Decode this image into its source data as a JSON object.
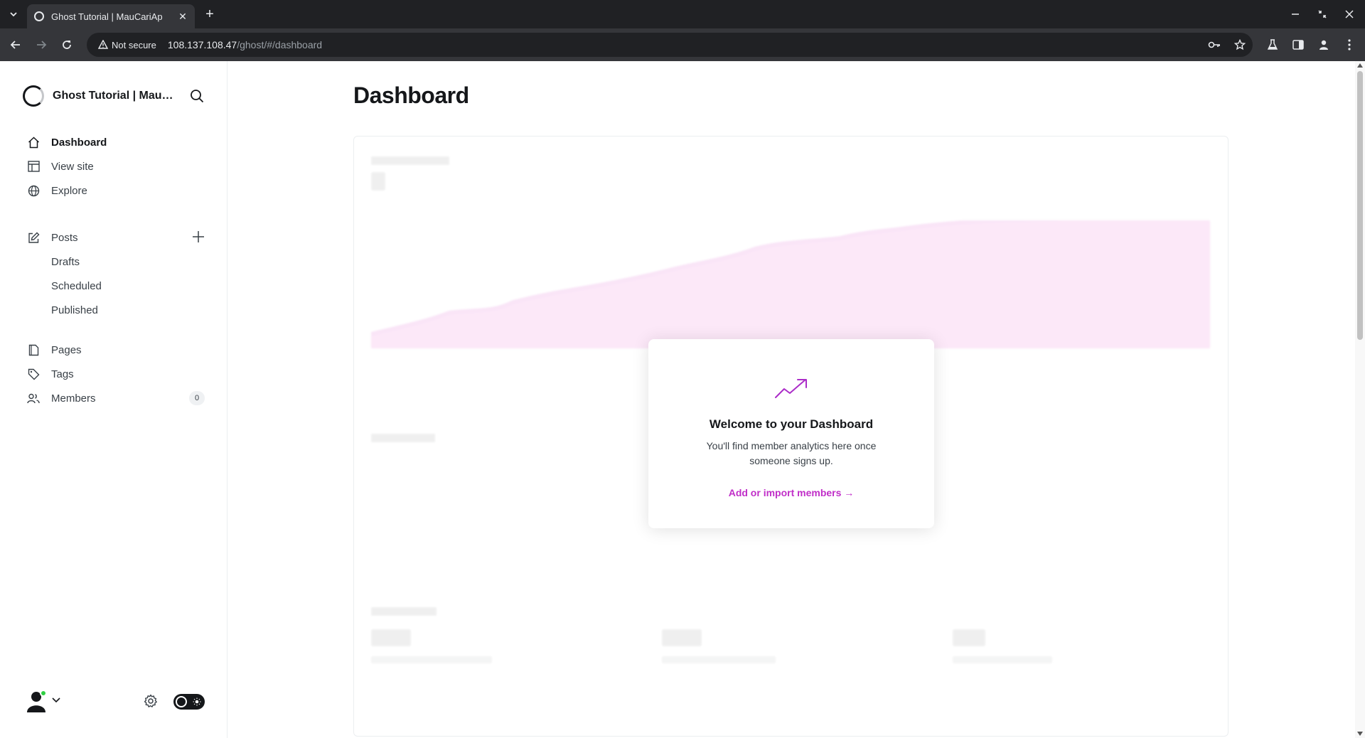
{
  "browser": {
    "tab_title": "Ghost Tutorial | MauCariAp",
    "security_label": "Not secure",
    "url_host": "108.137.108.47",
    "url_path": "/ghost/#/dashboard"
  },
  "sidebar": {
    "site_name": "Ghost Tutorial | MauCariApa",
    "nav": {
      "dashboard": "Dashboard",
      "view_site": "View site",
      "explore": "Explore",
      "posts": "Posts",
      "drafts": "Drafts",
      "scheduled": "Scheduled",
      "published": "Published",
      "pages": "Pages",
      "tags": "Tags",
      "members": "Members",
      "members_count": "0"
    }
  },
  "main": {
    "title": "Dashboard",
    "welcome": {
      "title": "Welcome to your Dashboard",
      "text": "You'll find member analytics here once someone signs up.",
      "link": "Add or import members →"
    }
  },
  "colors": {
    "accent": "#c02ec8",
    "online": "#30cf43"
  }
}
